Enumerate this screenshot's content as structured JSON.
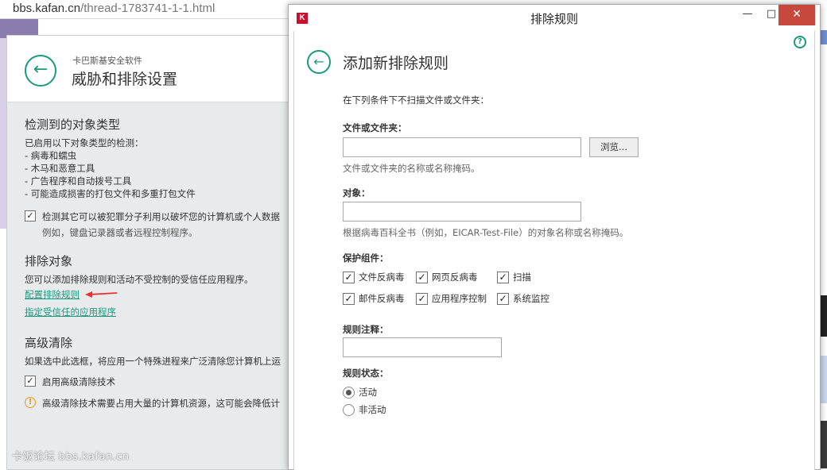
{
  "browser": {
    "url_host": "bbs.kafan.cn",
    "url_path": "/thread-1783741-1-1.html"
  },
  "kaspersky": {
    "app_name": "卡巴斯基安全软件",
    "page_title": "威胁和排除设置",
    "detected": {
      "title": "检测到的对象类型",
      "intro": "已启用以下对象类型的检测：",
      "items": [
        "- 病毒和蠕虫",
        "- 木马和恶意工具",
        "- 广告程序和自动拨号工具",
        "- 可能造成损害的打包文件和多重打包文件"
      ],
      "extra_checkbox_label": "检测其它可以被犯罪分子利用以破坏您的计算机或个人数据",
      "extra_checkbox_note": "例如，键盘记录器或者远程控制程序。",
      "extra_checked": true
    },
    "exclusions": {
      "title": "排除对象",
      "desc": "您可以添加排除规则和活动不受控制的受信任应用程序。",
      "link_rules": "配置排除规则",
      "link_trusted": "指定受信任的应用程序"
    },
    "advanced": {
      "title": "高级清除",
      "desc": "如果选中此选框，将应用一个特殊进程来广泛清除您计算机上运",
      "checkbox_label": "启用高级清除技术",
      "checked": true,
      "warning": "高级清除技术需要占用大量的计算机资源，这可能会降低计"
    },
    "watermark": "卡饭论坛 bbs.kafan.cn",
    "colors": {
      "accent": "#1a9a7e",
      "warning": "#e39a1a"
    }
  },
  "dialog": {
    "window_title": "排除规则",
    "logo_letter": "K",
    "heading": "添加新排除规则",
    "intro": "在下列条件下不扫描文件或文件夹：",
    "file_label": "文件或文件夹：",
    "file_value": "",
    "browse_label": "浏览...",
    "file_hint": "文件或文件夹的名称或名称掩码。",
    "object_label": "对象：",
    "object_value": "",
    "object_hint": "根据病毒百科全书（例如，EICAR-Test-File）的对象名称或名称掩码。",
    "components_label": "保护组件：",
    "components": [
      {
        "label": "文件反病毒",
        "checked": true
      },
      {
        "label": "网页反病毒",
        "checked": true
      },
      {
        "label": "扫描",
        "checked": true
      },
      {
        "label": "邮件反病毒",
        "checked": true
      },
      {
        "label": "应用程序控制",
        "checked": true
      },
      {
        "label": "系统监控",
        "checked": true
      }
    ],
    "comment_label": "规则注释：",
    "comment_value": "",
    "status_label": "规则状态：",
    "status_options": [
      {
        "label": "活动",
        "selected": true
      },
      {
        "label": "非活动",
        "selected": false
      }
    ],
    "colors": {
      "close_button": "#c7493e",
      "accent": "#1a9a7e"
    }
  }
}
